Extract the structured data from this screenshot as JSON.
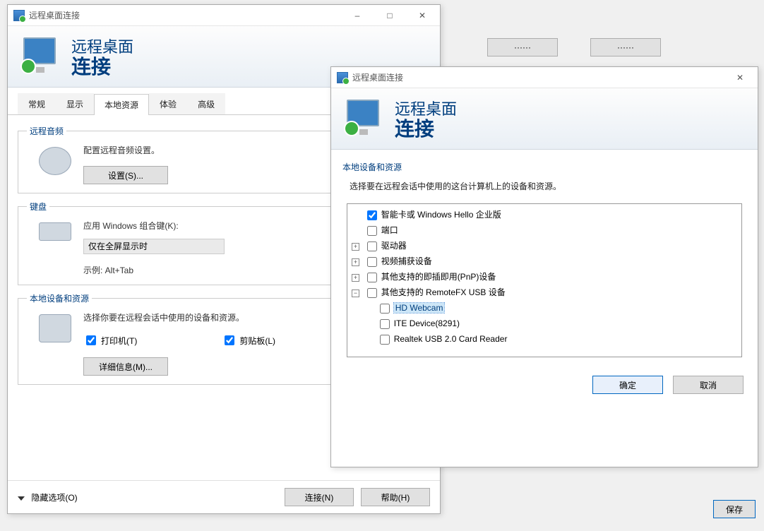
{
  "bg": {
    "btn1": "······",
    "btn2": "······",
    "save": "保存"
  },
  "win1": {
    "title": "远程桌面连接",
    "header_l1": "远程桌面",
    "header_l2": "连接",
    "tabs": [
      "常规",
      "显示",
      "本地资源",
      "体验",
      "高级"
    ],
    "audio": {
      "legend": "远程音频",
      "desc": "配置远程音频设置。",
      "btn": "设置(S)..."
    },
    "keyboard": {
      "legend": "键盘",
      "desc": "应用 Windows 组合键(K):",
      "dropdown": "仅在全屏显示时",
      "example": "示例: Alt+Tab"
    },
    "local": {
      "legend": "本地设备和资源",
      "desc": "选择你要在远程会话中使用的设备和资源。",
      "printer": "打印机(T)",
      "clipboard": "剪贴板(L)",
      "more": "详细信息(M)..."
    },
    "footer": {
      "options": "隐藏选项(O)",
      "connect": "连接(N)",
      "help": "帮助(H)"
    }
  },
  "win2": {
    "title": "远程桌面连接",
    "header_l1": "远程桌面",
    "header_l2": "连接",
    "section": "本地设备和资源",
    "desc": "选择要在远程会话中使用的这台计算机上的设备和资源。",
    "tree": {
      "smartcard": "智能卡或 Windows Hello 企业版",
      "ports": "端口",
      "drives": "驱动器",
      "video": "视频捕获设备",
      "pnp": "其他支持的即插即用(PnP)设备",
      "remotefx": "其他支持的 RemoteFX USB 设备",
      "children": {
        "hdwebcam": "HD Webcam",
        "ite": "ITE Device(8291)",
        "realtek": "Realtek USB 2.0 Card Reader"
      }
    },
    "ok": "确定",
    "cancel": "取消"
  }
}
